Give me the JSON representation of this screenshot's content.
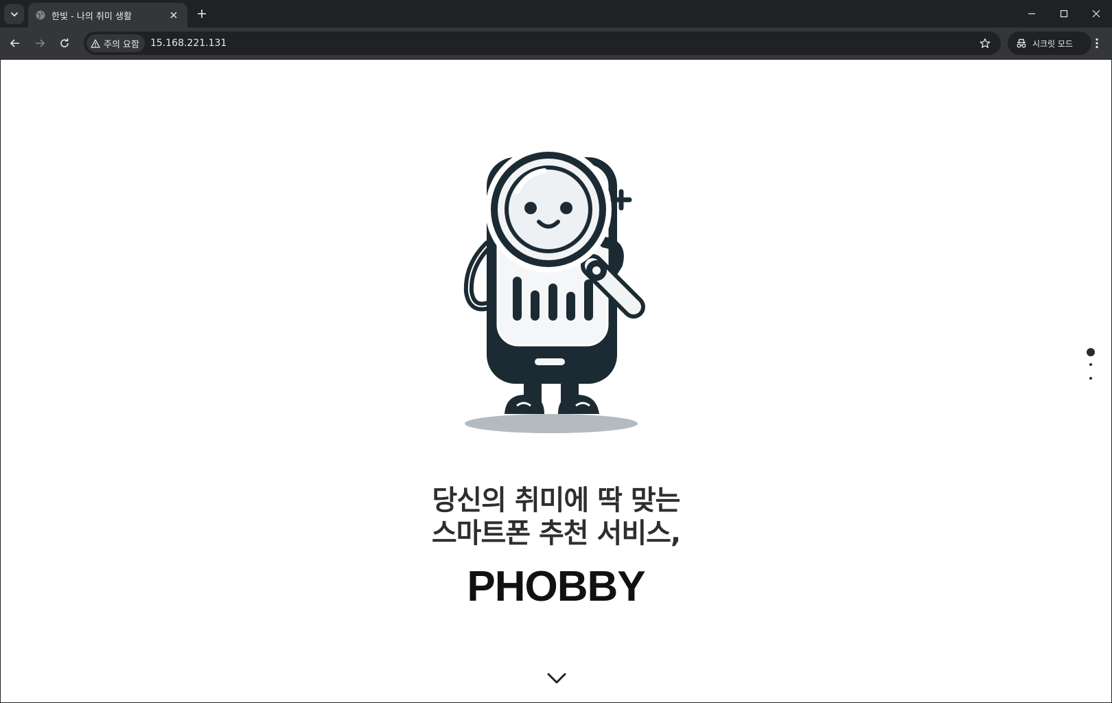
{
  "browser": {
    "tab": {
      "title": "한빛 - 나의 취미 생활"
    },
    "address": {
      "security_label": "주의 요함",
      "url": "15.168.221.131"
    },
    "profile_label": "시크릿 모드"
  },
  "page": {
    "headline_line1": "당신의 취미에 딱 맞는",
    "headline_line2": "스마트폰 추천 서비스,",
    "brand": "PHOBBY",
    "pagination": {
      "count": 3,
      "active": 1
    }
  },
  "colors": {
    "chrome_dark": "#202124",
    "chrome_toolbar": "#35363a",
    "mascot_dark": "#1c2b33",
    "page_bg": "#ffffff"
  }
}
